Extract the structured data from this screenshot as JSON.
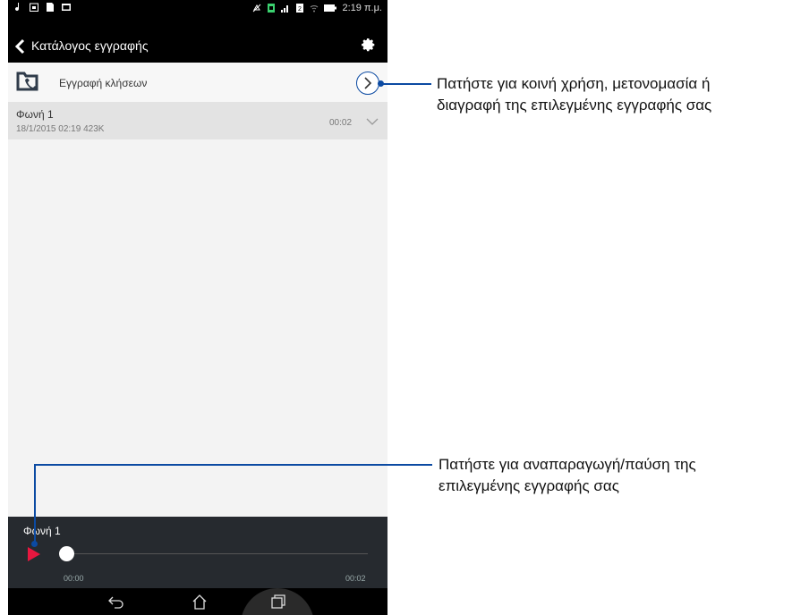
{
  "status_bar": {
    "left_icons": [
      "music-note-icon",
      "calendar-icon",
      "sd-card-icon",
      "image-icon"
    ],
    "right_icons": [
      "mute-icon",
      "sim-icon",
      "signal-icon",
      "sim2-icon",
      "wifi-icon",
      "battery-icon"
    ],
    "time": "2:19 π.μ."
  },
  "app_bar": {
    "title": "Κατάλογος εγγραφής"
  },
  "folder_row": {
    "label": "Εγγραφή κλήσεων"
  },
  "recordings": [
    {
      "name": "Φωνή 1",
      "meta": "18/1/2015 02:19  423K",
      "duration": "00:02"
    }
  ],
  "player": {
    "track_name": "Φωνή 1",
    "time_start": "00:00",
    "time_end": "00:02",
    "progress": 0
  },
  "callouts": {
    "share_line1": "Πατήστε για κοινή χρήση, μετονομασία ή",
    "share_line2": "διαγραφή της επιλεγμένης εγγραφής σας",
    "play_line1": "Πατήστε για αναπαραγωγή/παύση της",
    "play_line2": "επιλεγμένης εγγραφής σας"
  },
  "colors": {
    "accent_blue": "#0b4aa2",
    "play_red": "#e8173f",
    "player_bg": "#262a2f"
  }
}
